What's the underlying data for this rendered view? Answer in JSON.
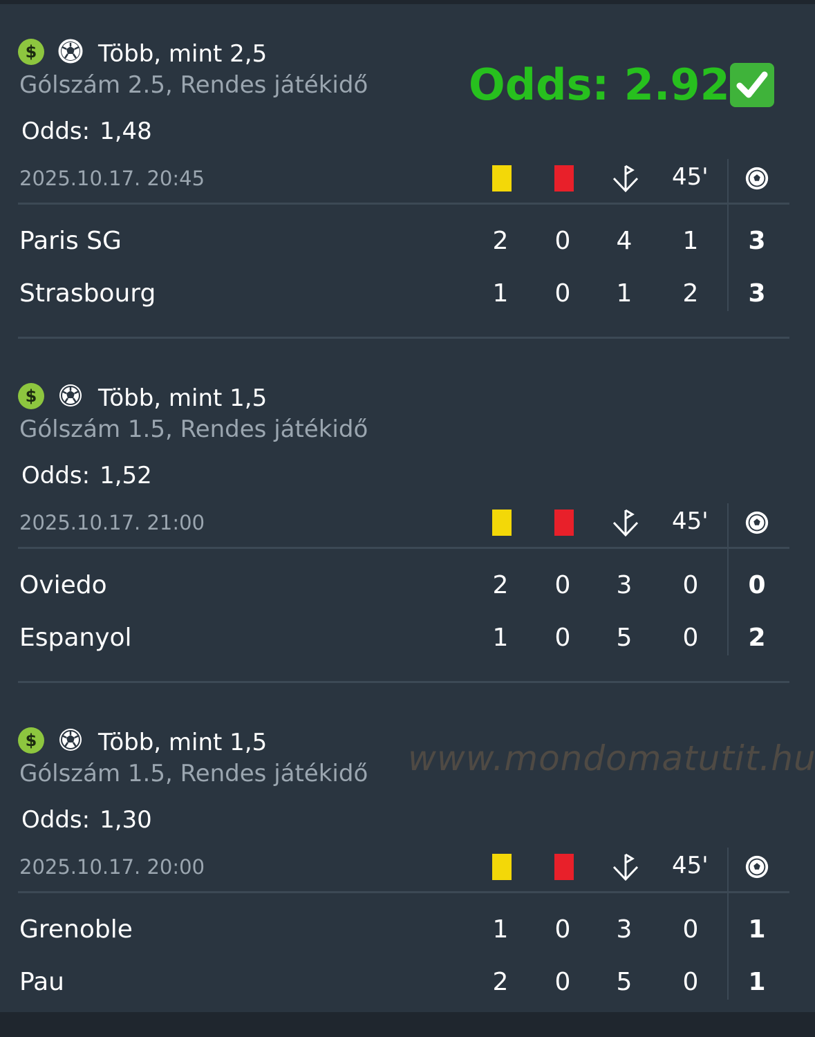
{
  "promo": {
    "text": "Odds: 2.92",
    "check_icon": "check-mark-icon",
    "color": "#27c01e"
  },
  "watermark": "www.mondomatutit.hu",
  "stat_headers": {
    "ht": "45'"
  },
  "colors": {
    "yellow_card": "#f3d808",
    "red_card": "#e8202a",
    "money": "#8dc63f"
  },
  "bets": [
    {
      "title": "Több, mint 2,5",
      "subtitle": "Gólszám 2.5, Rendes játékidő",
      "odds_label": "Odds:",
      "odds": "1,48",
      "datetime": "2025.10.17.  20:45",
      "teams": [
        {
          "name": "Paris SG",
          "yellow": "2",
          "red": "0",
          "corners": "4",
          "ht": "1",
          "goals": "3"
        },
        {
          "name": "Strasbourg",
          "yellow": "1",
          "red": "0",
          "corners": "1",
          "ht": "2",
          "goals": "3"
        }
      ]
    },
    {
      "title": "Több, mint 1,5",
      "subtitle": "Gólszám 1.5, Rendes játékidő",
      "odds_label": "Odds:",
      "odds": "1,52",
      "datetime": "2025.10.17.  21:00",
      "teams": [
        {
          "name": "Oviedo",
          "yellow": "2",
          "red": "0",
          "corners": "3",
          "ht": "0",
          "goals": "0"
        },
        {
          "name": "Espanyol",
          "yellow": "1",
          "red": "0",
          "corners": "5",
          "ht": "0",
          "goals": "2"
        }
      ]
    },
    {
      "title": "Több, mint 1,5",
      "subtitle": "Gólszám 1.5, Rendes játékidő",
      "odds_label": "Odds:",
      "odds": "1,30",
      "datetime": "2025.10.17.  20:00",
      "teams": [
        {
          "name": "Grenoble",
          "yellow": "1",
          "red": "0",
          "corners": "3",
          "ht": "0",
          "goals": "1"
        },
        {
          "name": "Pau",
          "yellow": "2",
          "red": "0",
          "corners": "5",
          "ht": "0",
          "goals": "1"
        }
      ]
    }
  ]
}
